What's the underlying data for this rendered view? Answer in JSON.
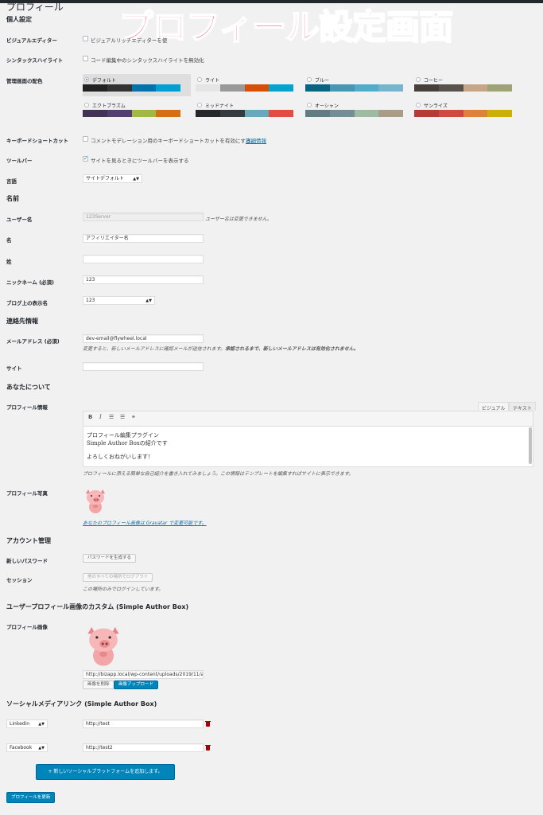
{
  "page_title": "プロフィール",
  "banner": "プロフィール設定画面",
  "personal": {
    "heading": "個人設定",
    "visual_editor": {
      "label": "ビジュアルエディター",
      "text": "ビジュアルリッチエディターを使"
    },
    "syntax": {
      "label": "シンタックスハイライト",
      "text": "コード編集中のシンタックスハイライトを無効化"
    },
    "color_scheme": {
      "label": "管理画面の配色",
      "schemes": [
        {
          "name": "デフォルト",
          "selected": true,
          "colors": [
            "#222222",
            "#333333",
            "#0073aa",
            "#00a0d2"
          ]
        },
        {
          "name": "ライト",
          "selected": false,
          "colors": [
            "#e5e5e5",
            "#999999",
            "#d64e07",
            "#04a4cc"
          ]
        },
        {
          "name": "ブルー",
          "selected": false,
          "colors": [
            "#096484",
            "#4796b3",
            "#52accc",
            "#74b6ce"
          ]
        },
        {
          "name": "コーヒー",
          "selected": false,
          "colors": [
            "#46403c",
            "#59524c",
            "#c7a589",
            "#9ea476"
          ]
        },
        {
          "name": "エクトプラズム",
          "selected": false,
          "colors": [
            "#413256",
            "#523f6d",
            "#a3b745",
            "#d46f15"
          ]
        },
        {
          "name": "ミッドナイト",
          "selected": false,
          "colors": [
            "#25282b",
            "#363b3f",
            "#69a8bb",
            "#e14d43"
          ]
        },
        {
          "name": "オーシャン",
          "selected": false,
          "colors": [
            "#627c83",
            "#738e96",
            "#9ebaa0",
            "#aa9d88"
          ]
        },
        {
          "name": "サンライズ",
          "selected": false,
          "colors": [
            "#b43c38",
            "#cf4944",
            "#dd823b",
            "#ccaf0b"
          ]
        }
      ]
    },
    "keyboard": {
      "label": "キーボードショートカット",
      "text": "コメントモデレーション用のキーボードショートカットを有効にする。",
      "link": "詳細情報"
    },
    "toolbar": {
      "label": "ツールバー",
      "text": "サイトを見るときにツールバーを表示する"
    },
    "language": {
      "label": "言語",
      "value": "サイトデフォルト"
    }
  },
  "name": {
    "heading": "名前",
    "username": {
      "label": "ユーザー名",
      "value": "123Server",
      "note": "ユーザー名は変更できません。"
    },
    "first": {
      "label": "名",
      "value": "アフィリエイター名"
    },
    "last": {
      "label": "姓",
      "value": ""
    },
    "nickname": {
      "label": "ニックネーム (必須)",
      "value": "123"
    },
    "display": {
      "label": "ブログ上の表示名",
      "value": "123"
    }
  },
  "contact": {
    "heading": "連絡先情報",
    "email": {
      "label": "メールアドレス (必須)",
      "value": "dev-email@flywheel.local",
      "note1": "変更すると、新しいメールアドレスに確認メールが送信されます。",
      "note2": "承認されるまで、新しいメールアドレスは有効化されません。"
    },
    "site": {
      "label": "サイト",
      "value": ""
    }
  },
  "about": {
    "heading": "あなたについて",
    "bio": {
      "label": "プロフィール情報",
      "tab_visual": "ビジュアル",
      "tab_text": "テキスト",
      "lines": [
        "プロフィール編集プラグイン",
        "Simple Author Boxの紹介です",
        "よろしくおねがいします！"
      ],
      "note": "プロフィールに添える簡単な自己紹介を書き入れてみましょう。この情報はテンプレートを編集すればサイトに表示できます。"
    },
    "photo": {
      "label": "プロフィール写真",
      "note": "あなたのプロフィール画像は Gravatar で変更可能です。"
    }
  },
  "account": {
    "heading": "アカウント管理",
    "password": {
      "label": "新しいパスワード",
      "button": "パスワードを生成する"
    },
    "sessions": {
      "label": "セッション",
      "button": "他のすべての場所でログアウト",
      "note": "この場所のみでログインしています。"
    }
  },
  "sab": {
    "heading": "ユーザープロフィール画像のカスタム (Simple Author Box)",
    "image": {
      "label": "プロフィール画像",
      "url": "http://bizapp.local/wp-content/uploads/2019/11/anim",
      "delete": "画像を削除",
      "upload": "画像アップロード"
    }
  },
  "social": {
    "heading": "ソーシャルメディアリンク (Simple Author Box)",
    "rows": [
      {
        "platform": "Linkedin",
        "url": "http://test"
      },
      {
        "platform": "Facebook",
        "url": "http://test2"
      }
    ],
    "add": "+ 新しいソーシャルプラットフォームを追加します。"
  },
  "submit": "プロフィールを更新"
}
